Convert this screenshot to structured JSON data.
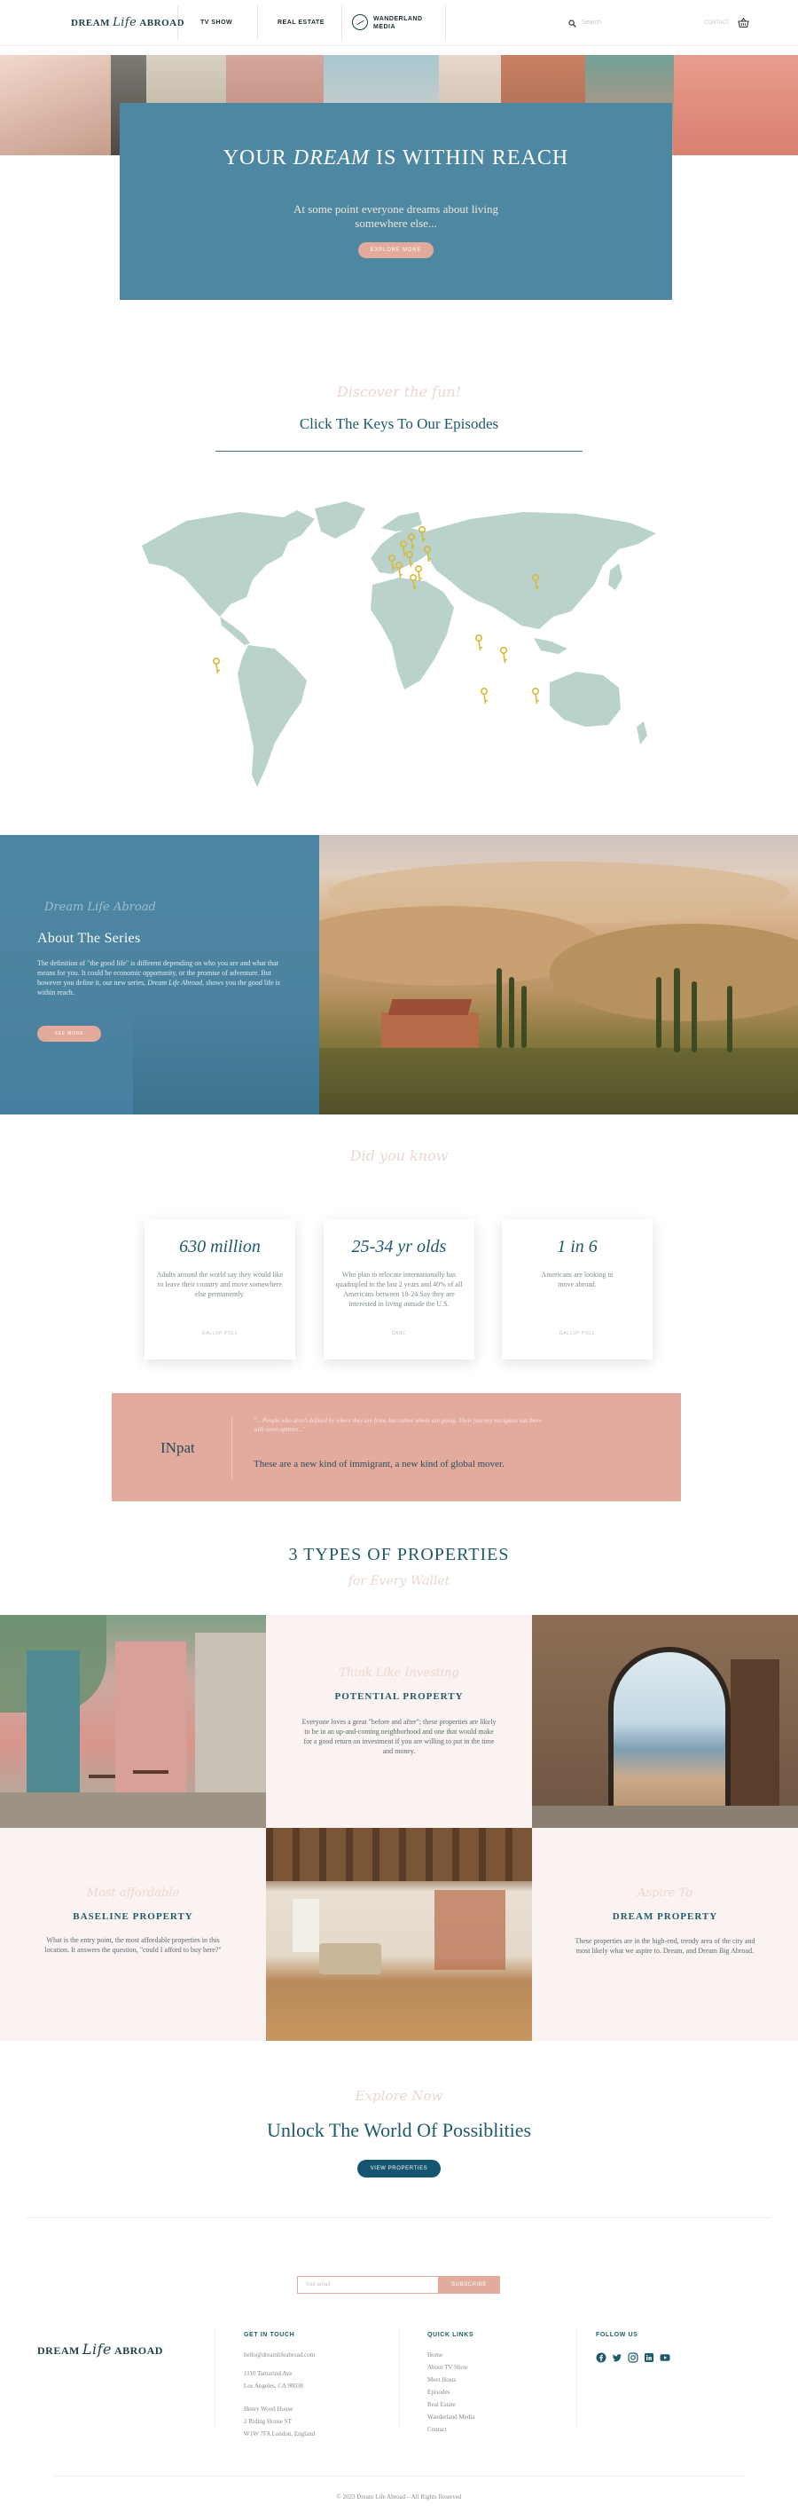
{
  "nav": {
    "logo_left": "DREAM",
    "logo_script": "Life",
    "logo_right": "ABROAD",
    "links": [
      "TV SHOW",
      "REAL ESTATE"
    ],
    "wander_label_line1": "WANDERLAND",
    "wander_label_line2": "MEDIA",
    "search_placeholder": "Search",
    "small_link": "CONTACT"
  },
  "hero": {
    "title_pre": "YOUR ",
    "title_em": "DREAM",
    "title_post": " IS WITHIN REACH",
    "subtitle": "At some point everyone dreams about living somewhere else...",
    "button": "EXPLORE MORE"
  },
  "episodes": {
    "script": "Discover the fun!",
    "title": "Click The Keys To Our Episodes"
  },
  "about": {
    "script": "Dream Life Abroad",
    "title": "About The Series",
    "text_1": "The definition of \"the good life\" is different depending on who you are and what that means for you. It could be economic opportunity, or the promise of adventure. But however you define it, our new series, ",
    "text_em": "Dream Life Abroad,",
    "text_2": " shows you the good life is within reach.",
    "button": "SEE MORE"
  },
  "stats": {
    "script": "Did you know",
    "items": [
      {
        "number": "630 million",
        "desc": "Adults around the world say they would like to leave their country and move somewhere else permanently.",
        "source": "GALLUP POLL"
      },
      {
        "number": "25-34 yr olds",
        "desc": "Who plan to relocate internationally has quadrupled in the last 2 years and 40% of all Americans between 18-24 Say they are interested in living outside the U.S.",
        "source": "CNBC"
      },
      {
        "number": "1 in 6",
        "desc": "Americans are looking to move abroad.",
        "source": "GALLUP POLL"
      }
    ]
  },
  "quote": {
    "name": "INpat",
    "small": "\"... People who aren't defined by where they are from, but rather where are going. Their journey navigates out there with more options...\"",
    "main_1": "These are a new kind of immigrant, a new kind of ",
    "main_em": "global mover.",
    "main_2": ""
  },
  "properties": {
    "title": "3 TYPES OF PROPERTIES",
    "script": "for Every Wallet",
    "potential": {
      "script": "Think Like Investing",
      "name": "POTENTIAL PROPERTY",
      "desc": "Everyone loves a great \"before and after\"; these properties are likely to be in an up-and-coming neighborhood and one that would make for a good return on investment if you are willing to put in the time and money."
    },
    "baseline": {
      "script": "Most affordable",
      "name": "BASELINE PROPERTY",
      "desc": "What is the entry point, the most affordable properties in this location. It answers the question, \"could I afford to buy here?\""
    },
    "dream": {
      "script": "Aspire To",
      "name": "DREAM PROPERTY",
      "desc_1": "These properties are in the high-end, trendy area of the city and most likely what we aspire to. ",
      "desc_2": "Dream, and Dream Big Abroad."
    }
  },
  "unlock": {
    "script": "Explore Now",
    "title": "Unlock The World Of Possiblities",
    "button": "VIEW PROPERTIES"
  },
  "footer": {
    "email_placeholder": "Your email",
    "subscribe": "SUBSCRIBE",
    "get_in_touch": "GET IN TOUCH",
    "email": "hello@dreamlifeabroad.com",
    "addr1_l1": "1110 Tamarind Ave",
    "addr1_l2": "Los Angeles, CA 90038",
    "addr2_l1": "Henry Wood House",
    "addr2_l2": "2 Riding House ST",
    "addr2_l3": "W1W 7FA London, England",
    "quick_links": "QUICK LINKS",
    "links": [
      "Home",
      "About TV Show",
      "Meet Hosts",
      "Episodes",
      "Real Estate",
      "Wanderland Media",
      "Contact"
    ],
    "follow_us": "FOLLOW US",
    "social_icons": [
      "facebook-icon",
      "twitter-icon",
      "instagram-icon",
      "linkedin-icon",
      "youtube-icon"
    ],
    "copyright": "© 2023 Dream Life Abroad – All Rights Reserved"
  },
  "colors": {
    "teal": "#4e87a1",
    "dark_teal": "#1f5a6a",
    "pink": "#e3aa9e",
    "blush": "#fbf3f1",
    "map": "#b9d3cc",
    "key": "#d9b83a"
  }
}
